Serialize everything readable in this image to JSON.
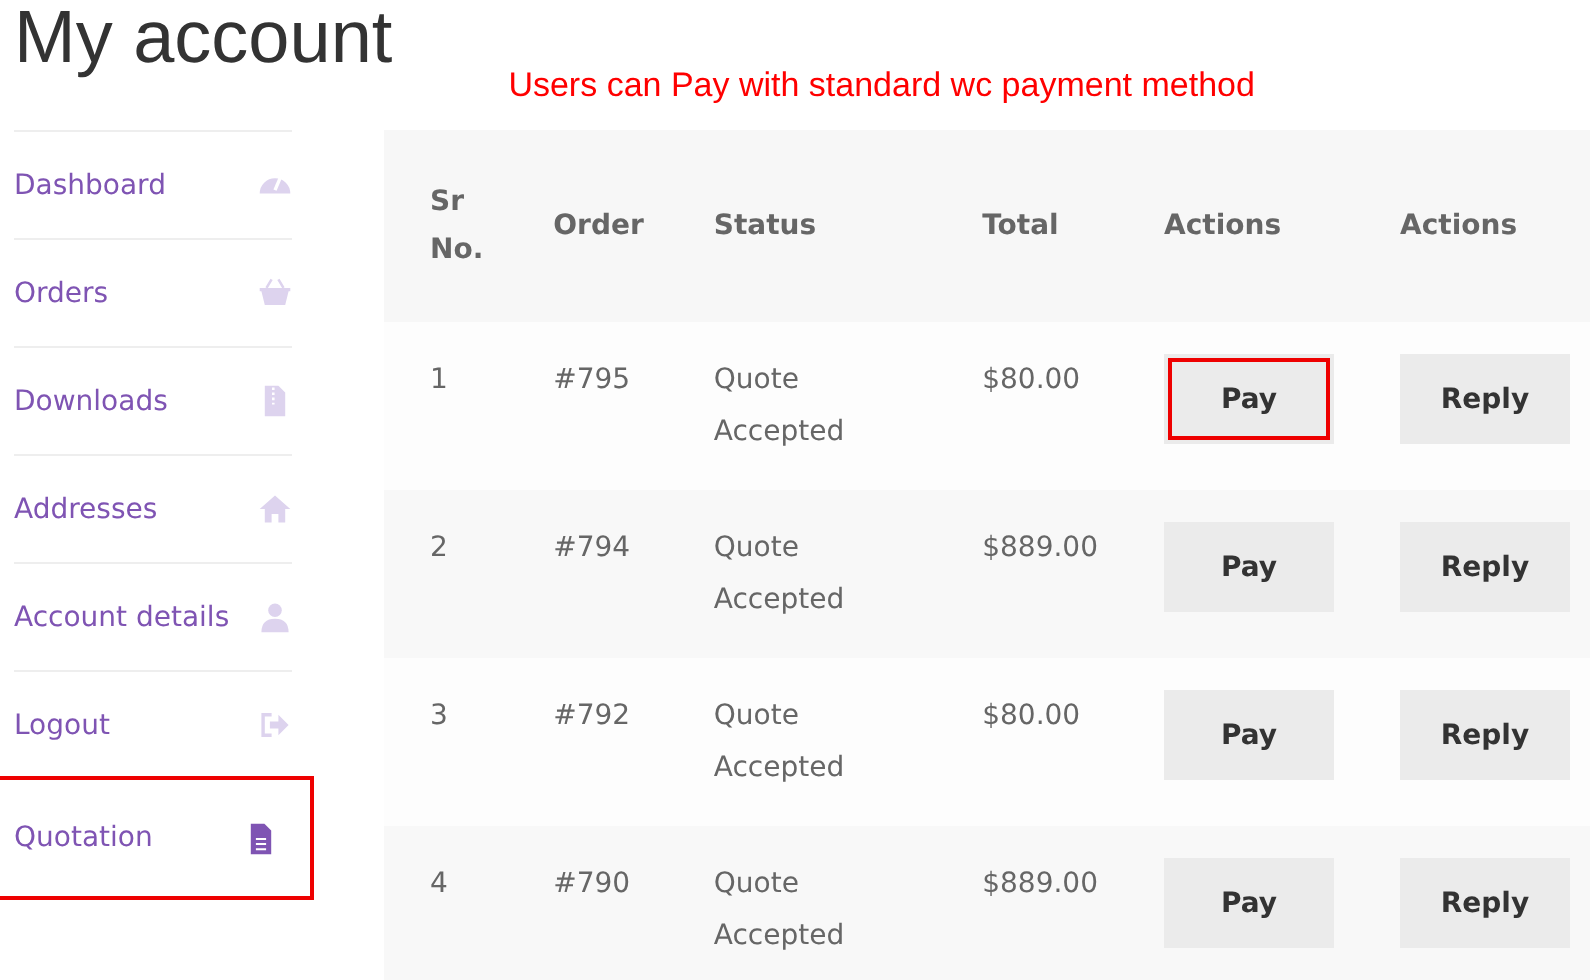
{
  "page_title": "My account",
  "annotation": "Users can Pay with standard wc payment method",
  "nav": [
    {
      "label": "Dashboard",
      "kind": "gauge",
      "selected": false,
      "highlighted": false
    },
    {
      "label": "Orders",
      "kind": "basket",
      "selected": false,
      "highlighted": false
    },
    {
      "label": "Downloads",
      "kind": "archive",
      "selected": false,
      "highlighted": false
    },
    {
      "label": "Addresses",
      "kind": "house",
      "selected": false,
      "highlighted": false
    },
    {
      "label": "Account details",
      "kind": "person",
      "selected": false,
      "highlighted": false
    },
    {
      "label": "Logout",
      "kind": "exit",
      "selected": false,
      "highlighted": false
    },
    {
      "label": "Quotation",
      "kind": "document",
      "selected": true,
      "highlighted": true
    }
  ],
  "table": {
    "columns": [
      "Sr No.",
      "Order",
      "Status",
      "Total",
      "Actions",
      "Actions"
    ],
    "rows": [
      {
        "sr": "1",
        "order": "#795",
        "status": "Quote Accepted",
        "total": "$80.00",
        "pay": "Pay",
        "reply": "Reply",
        "pay_highlighted": true
      },
      {
        "sr": "2",
        "order": "#794",
        "status": "Quote Accepted",
        "total": "$889.00",
        "pay": "Pay",
        "reply": "Reply",
        "pay_highlighted": false
      },
      {
        "sr": "3",
        "order": "#792",
        "status": "Quote Accepted",
        "total": "$80.00",
        "pay": "Pay",
        "reply": "Reply",
        "pay_highlighted": false
      },
      {
        "sr": "4",
        "order": "#790",
        "status": "Quote Accepted",
        "total": "$889.00",
        "pay": "Pay",
        "reply": "Reply",
        "pay_highlighted": false
      }
    ]
  }
}
